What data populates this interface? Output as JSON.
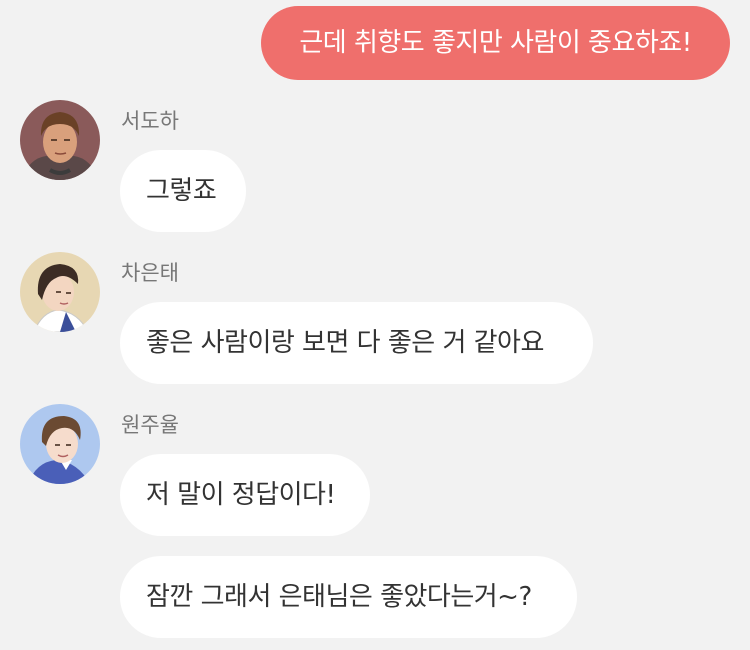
{
  "messages": {
    "m1": {
      "sender": "me",
      "text": "근데 취향도 좋지만 사람이 중요하죠!"
    },
    "m2": {
      "sender": "서도하",
      "text": "그렇죠"
    },
    "m3": {
      "sender": "차은태",
      "text": "좋은 사람이랑 보면 다 좋은 거 같아요"
    },
    "m4": {
      "sender": "원주율",
      "text": "저 말이 정답이다!"
    },
    "m5": {
      "sender": "원주율",
      "text": "잠깐 그래서 은태님은 좋았다는거~?"
    }
  },
  "colors": {
    "background": "#f2f2f2",
    "my_bubble": "#ef6f6c",
    "their_bubble": "#ffffff",
    "sender_name": "#777777"
  },
  "avatars": {
    "doha": "avatar-portrait-doha",
    "euntae": "avatar-portrait-euntae",
    "juyul": "avatar-portrait-juyul"
  }
}
